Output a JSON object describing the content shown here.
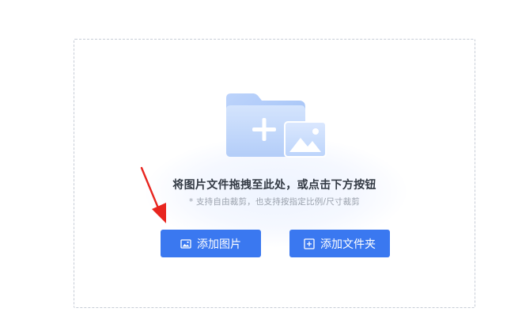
{
  "drop_zone": {
    "heading": "将图片文件拖拽至此处，或点击下方按钮",
    "subtext": "* 支持自由裁剪，也支持按指定比例/尺寸裁剪"
  },
  "buttons": {
    "add_image_label": "添加图片",
    "add_folder_label": "添加文件夹",
    "add_image_icon": "image-icon",
    "add_folder_icon": "plus-square-icon"
  },
  "illustration": {
    "icon": "folder-add-image-icon"
  },
  "annotation": {
    "icon": "red-arrow-icon"
  },
  "colors": {
    "primary": "#3a78f0",
    "annotation": "#e8251f",
    "folder_light": "#c9dcfb",
    "folder_dark": "#a9c7f7"
  }
}
